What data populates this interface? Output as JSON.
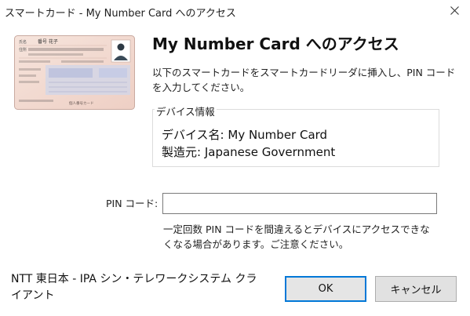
{
  "window": {
    "title": "スマートカード - My Number Card へのアクセス"
  },
  "card": {
    "name_label": "氏名",
    "name_value": "番号 花子",
    "address_label": "住所",
    "card_caption": "個人番号カード"
  },
  "main": {
    "heading": "My Number Card へのアクセス",
    "description": "以下のスマートカードをスマートカードリーダに挿入し、PIN コードを入力してください。"
  },
  "device": {
    "group_title": "デバイス情報",
    "name_line": "デバイス名: My Number Card",
    "maker_line": "製造元: Japanese Government"
  },
  "pin": {
    "label": "PIN コード:",
    "value": "",
    "placeholder": "",
    "warning": "一定回数 PIN コードを間違えるとデバイスにアクセスできなくなる場合があります。ご注意ください。"
  },
  "footer": {
    "publisher": "NTT 東日本 - IPA シン・テレワークシステム クライアント",
    "ok_label": "OK",
    "cancel_label": "キャンセル"
  },
  "colors": {
    "accent": "#0078d7",
    "card_bg": "#f3dcd4"
  },
  "icons": {
    "close": "close-icon"
  }
}
